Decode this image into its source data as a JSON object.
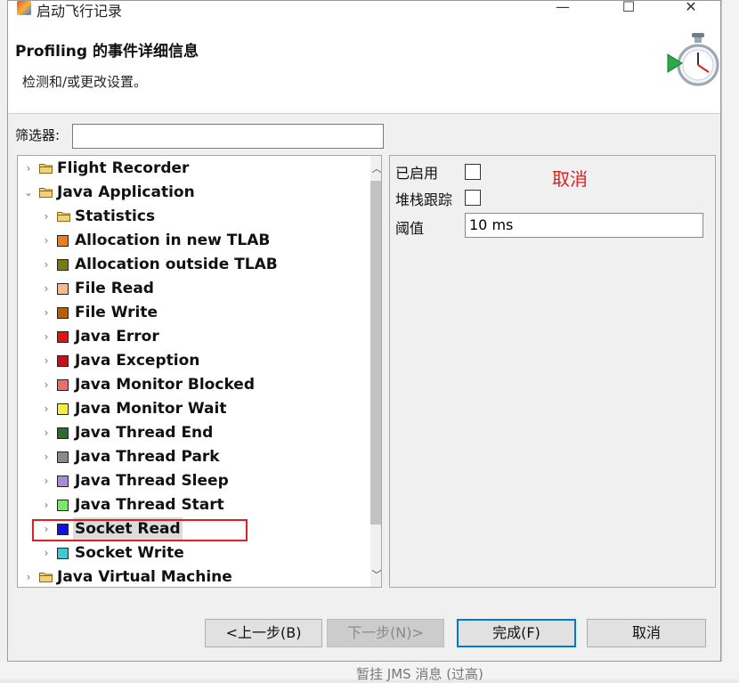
{
  "window": {
    "title": "启动飞行记录",
    "controls": {
      "minimize": "—",
      "maximize": "☐",
      "close": "✕"
    }
  },
  "header": {
    "heading": "Profiling 的事件详细信息",
    "subtitle": "检测和/或更改设置。",
    "icon": "stopwatch-play-icon"
  },
  "filter": {
    "label": "筛选器:",
    "value": ""
  },
  "tree": [
    {
      "label": "Flight Recorder",
      "indent": 0,
      "kind": "folder",
      "expanded": false
    },
    {
      "label": "Java Application",
      "indent": 0,
      "kind": "folder",
      "expanded": true
    },
    {
      "label": "Statistics",
      "indent": 1,
      "kind": "folder",
      "expanded": false
    },
    {
      "label": "Allocation in new TLAB",
      "indent": 1,
      "kind": "event",
      "color": "#f27d18",
      "expanded": false
    },
    {
      "label": "Allocation outside TLAB",
      "indent": 1,
      "kind": "event",
      "color": "#7a7a14",
      "expanded": false
    },
    {
      "label": "File Read",
      "indent": 1,
      "kind": "event",
      "color": "#f9b98a",
      "expanded": false
    },
    {
      "label": "File Write",
      "indent": 1,
      "kind": "event",
      "color": "#b85f08",
      "expanded": false
    },
    {
      "label": "Java Error",
      "indent": 1,
      "kind": "event",
      "color": "#e81010",
      "expanded": false
    },
    {
      "label": "Java Exception",
      "indent": 1,
      "kind": "event",
      "color": "#c8101a",
      "expanded": false
    },
    {
      "label": "Java Monitor Blocked",
      "indent": 1,
      "kind": "event",
      "color": "#f56a6a",
      "expanded": false
    },
    {
      "label": "Java Monitor Wait",
      "indent": 1,
      "kind": "event",
      "color": "#f6ee3c",
      "expanded": false
    },
    {
      "label": "Java Thread End",
      "indent": 1,
      "kind": "event",
      "color": "#2e6b2a",
      "expanded": false
    },
    {
      "label": "Java Thread Park",
      "indent": 1,
      "kind": "event",
      "color": "#8a8a8a",
      "expanded": false
    },
    {
      "label": "Java Thread Sleep",
      "indent": 1,
      "kind": "event",
      "color": "#a98ad8",
      "expanded": false
    },
    {
      "label": "Java Thread Start",
      "indent": 1,
      "kind": "event",
      "color": "#7ae86a",
      "expanded": false
    },
    {
      "label": "Socket Read",
      "indent": 1,
      "kind": "event",
      "color": "#1010f0",
      "expanded": false,
      "selected": true
    },
    {
      "label": "Socket Write",
      "indent": 1,
      "kind": "event",
      "color": "#3ec8d8",
      "expanded": false
    },
    {
      "label": "Java Virtual Machine",
      "indent": 0,
      "kind": "folder",
      "expanded": false
    }
  ],
  "settings": {
    "enabled_label": "已启用",
    "enabled": false,
    "stacktrace_label": "堆栈跟踪",
    "stacktrace": false,
    "threshold_label": "阈值",
    "threshold_value": "10 ms",
    "annotation": "取消"
  },
  "buttons": {
    "back": "<上一步(B)",
    "next": "下一步(N)>",
    "finish": "完成(F)",
    "cancel": "取消"
  },
  "background": {
    "bottom_text": "暂挂 JMS 消息 (过高)"
  },
  "colors": {
    "accent": "#0078d7",
    "highlight_red": "#e02020"
  }
}
